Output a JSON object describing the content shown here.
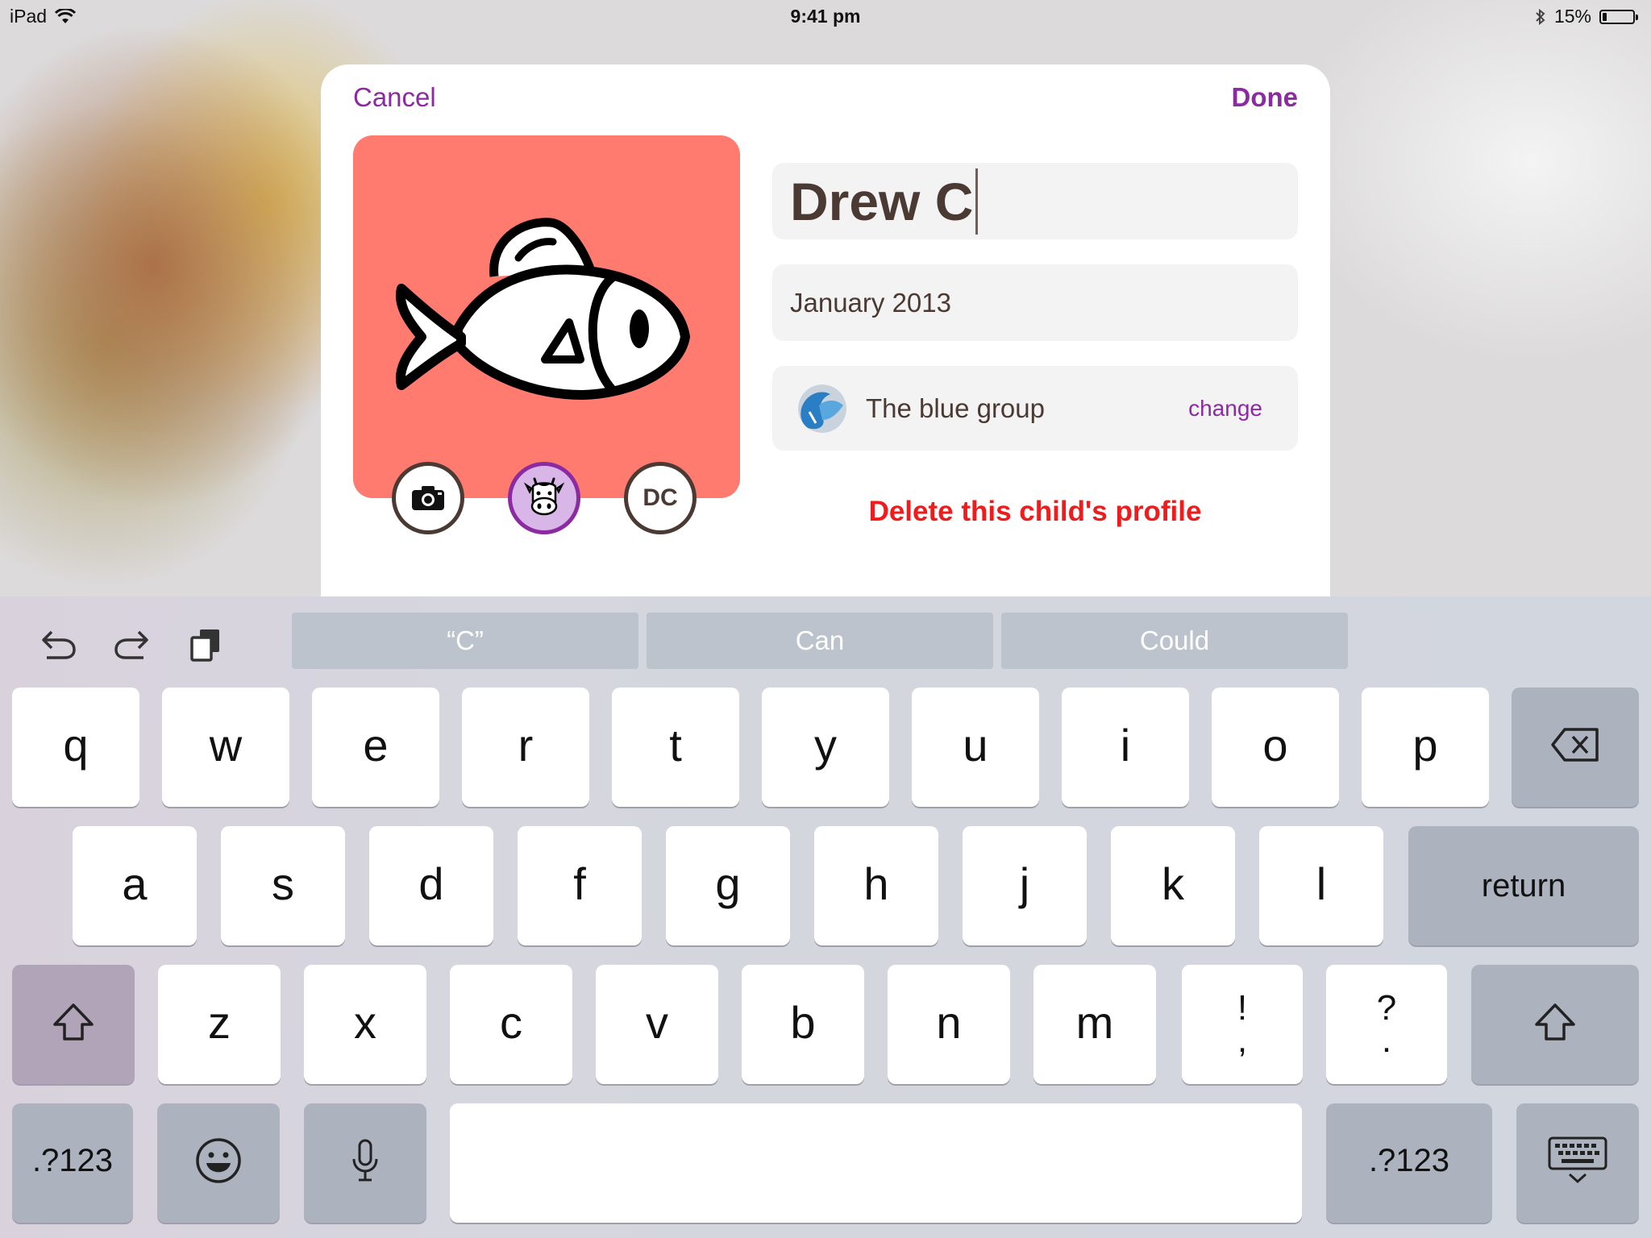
{
  "status_bar": {
    "device": "iPad",
    "time": "9:41 pm",
    "battery": "15%",
    "battery_level": 0.15
  },
  "sheet": {
    "cancel_label": "Cancel",
    "done_label": "Done",
    "name_value": "Drew C",
    "dob_value": "January 2013",
    "group_name": "The blue group",
    "change_label": "change",
    "delete_label": "Delete this child's profile",
    "initials": "DC"
  },
  "keyboard": {
    "suggestions": [
      "“C”",
      "Can",
      "Could"
    ],
    "row1": [
      "q",
      "w",
      "e",
      "r",
      "t",
      "y",
      "u",
      "i",
      "o",
      "p"
    ],
    "row2": [
      "a",
      "s",
      "d",
      "f",
      "g",
      "h",
      "j",
      "k",
      "l"
    ],
    "row3": [
      "z",
      "x",
      "c",
      "v",
      "b",
      "n",
      "m"
    ],
    "punct1": [
      "!",
      ","
    ],
    "punct2": [
      "?",
      "."
    ],
    "return_label": "return",
    "numbers_label": ".?123"
  },
  "colors": {
    "accent": "#8c2aa2",
    "avatar_bg": "#ff7b70",
    "delete": "#ee1c1c",
    "text": "#4a3a33"
  }
}
